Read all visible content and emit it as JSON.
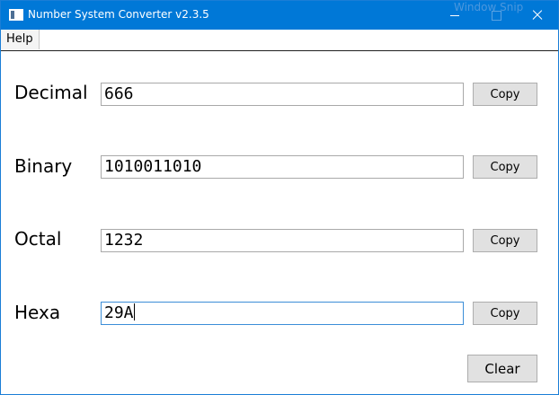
{
  "window": {
    "title": "Number System Converter v2.3.5",
    "ghost_text": "Window Snip",
    "accent": "#0078d7"
  },
  "menu": {
    "help_label": "Help"
  },
  "fields": {
    "decimal": {
      "label": "Decimal",
      "value": "666",
      "copy_label": "Copy"
    },
    "binary": {
      "label": "Binary",
      "value": "1010011010",
      "copy_label": "Copy"
    },
    "octal": {
      "label": "Octal",
      "value": "1232",
      "copy_label": "Copy"
    },
    "hexa": {
      "label": "Hexa",
      "value": "29A",
      "copy_label": "Copy"
    }
  },
  "actions": {
    "clear_label": "Clear"
  },
  "icons": {
    "app": "app-window-icon",
    "minimize": "minimize-icon",
    "maximize": "maximize-icon",
    "close": "close-icon"
  }
}
